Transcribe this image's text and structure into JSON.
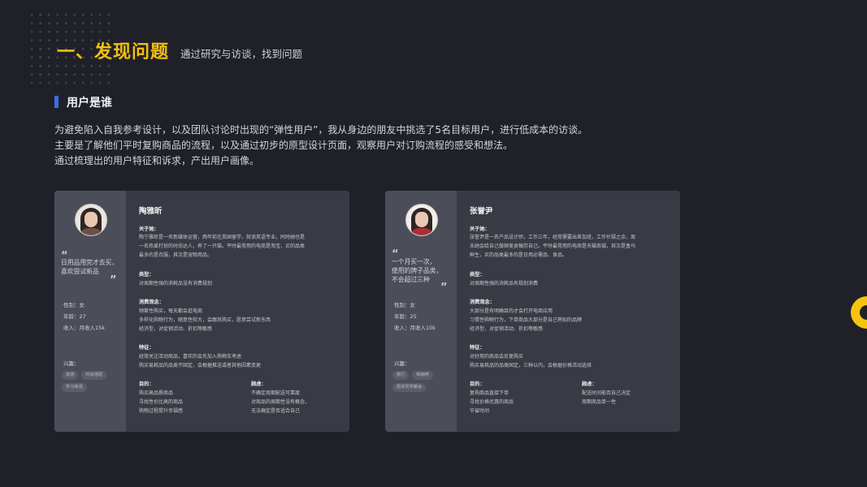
{
  "header": {
    "title": "一、发现问题",
    "subtitle": "通过研究与访谈，找到问题"
  },
  "section": {
    "title": "用户是谁"
  },
  "intro": [
    "为避免陷入自我参考设计，以及团队讨论时出现的“弹性用户”，我从身边的朋友中挑选了5名目标用户，进行低成本的访谈。",
    "主要是了解他们平时复购商品的流程，以及通过初步的原型设计页面，观察用户对订购流程的感受和想法。",
    "通过梳理出的用户特征和诉求，产出用户画像。"
  ],
  "personas": [
    {
      "name": "陶雅昕",
      "quote": [
        "日用品用完才去买，",
        "喜欢尝试新品"
      ],
      "gender": "性别：女",
      "age": "年龄：27",
      "income": "收入：月收入15k",
      "hobby_label": "兴趣：",
      "tags": [
        "旅游",
        "时尚搭配",
        "学习英语"
      ],
      "about_label": "关于她：",
      "about": [
        "陶宁雅昕是一名新媒体运营，两年前在英国留学，就读英语专业。同时她也是",
        "一名热爱打扮的时尚达人，养了一只猫。平时最常用的电商是淘宝，买的品类",
        "最多的是衣服，其次是宠物用品。"
      ],
      "type_label": "类型：",
      "type": "对周期性强的消耗品没有消费规划",
      "view_label": "消费观念：",
      "view": [
        "频繁性购买，每天都会逛电商",
        "多样化购物行为，随意性较大，会跟风购买，愿意尝试新东西",
        "经济型，对促销活动、折扣等敏感"
      ],
      "trait_label": "特征：",
      "trait": [
        "经常关注活动商品，喜欢的会先加入购物车考虑",
        "购买易耗品的品类不固定，会根据推送或者其他因素变更"
      ],
      "goal_label": "目的：",
      "goals": [
        "购买高品质商品",
        "寻找性价比高的商品",
        "购物过程提升幸福感"
      ],
      "worry_label": "顾虑：",
      "worries": [
        "不确定周期配送可靠度",
        "对商品的周期性没有概念，",
        "无法确定是否适合自己"
      ]
    },
    {
      "name": "张誉尹",
      "quote": [
        "一个月买一次，",
        "使用的牌子品类，",
        "不会超过三种"
      ],
      "gender": "性别：女",
      "age": "年龄：25",
      "income": "收入：月收入10k",
      "hobby_label": "兴趣：",
      "tags": [
        "旅行",
        "喝咖啡",
        "周末同学聚会"
      ],
      "about_label": "关于她：",
      "about": [
        "张誉尹是一名产品设计师，工作三年，经常需要出差加班，工作忙碌之余，周",
        "末她会给自己做顿美食犒劳自己。平时最常用的电商是天猫商城，其次是盒马",
        "鲜生，买的品类最多的是日用必需品、食品。"
      ],
      "type_label": "类型：",
      "type": "对周期性强的消耗品有规划消费",
      "view_label": "消费观念：",
      "view": [
        "大部分是有明确目的才会打开电商应用",
        "习惯性购物行为，下单商品大部分是自己熟知的品牌",
        "经济型，对促销活动、折扣等敏感"
      ],
      "trait_label": "特征：",
      "trait": [
        "对好用的商品会反复购买",
        "购买易耗品的品类固定，三种以内，会根据价格活动选择"
      ],
      "goal_label": "目的：",
      "goals": [
        "复购商品直接下单",
        "寻找价格优惠的商品",
        "节省时间"
      ],
      "worry_label": "顾虑：",
      "worries": [
        "配送时间能否自己决定",
        "周期商品单一性"
      ]
    }
  ],
  "colors": {
    "background": "#202128",
    "accent_yellow": "#f3bf12",
    "accent_blue": "#3f6be8",
    "card": "#393b44",
    "card_side": "#4b4e58"
  }
}
